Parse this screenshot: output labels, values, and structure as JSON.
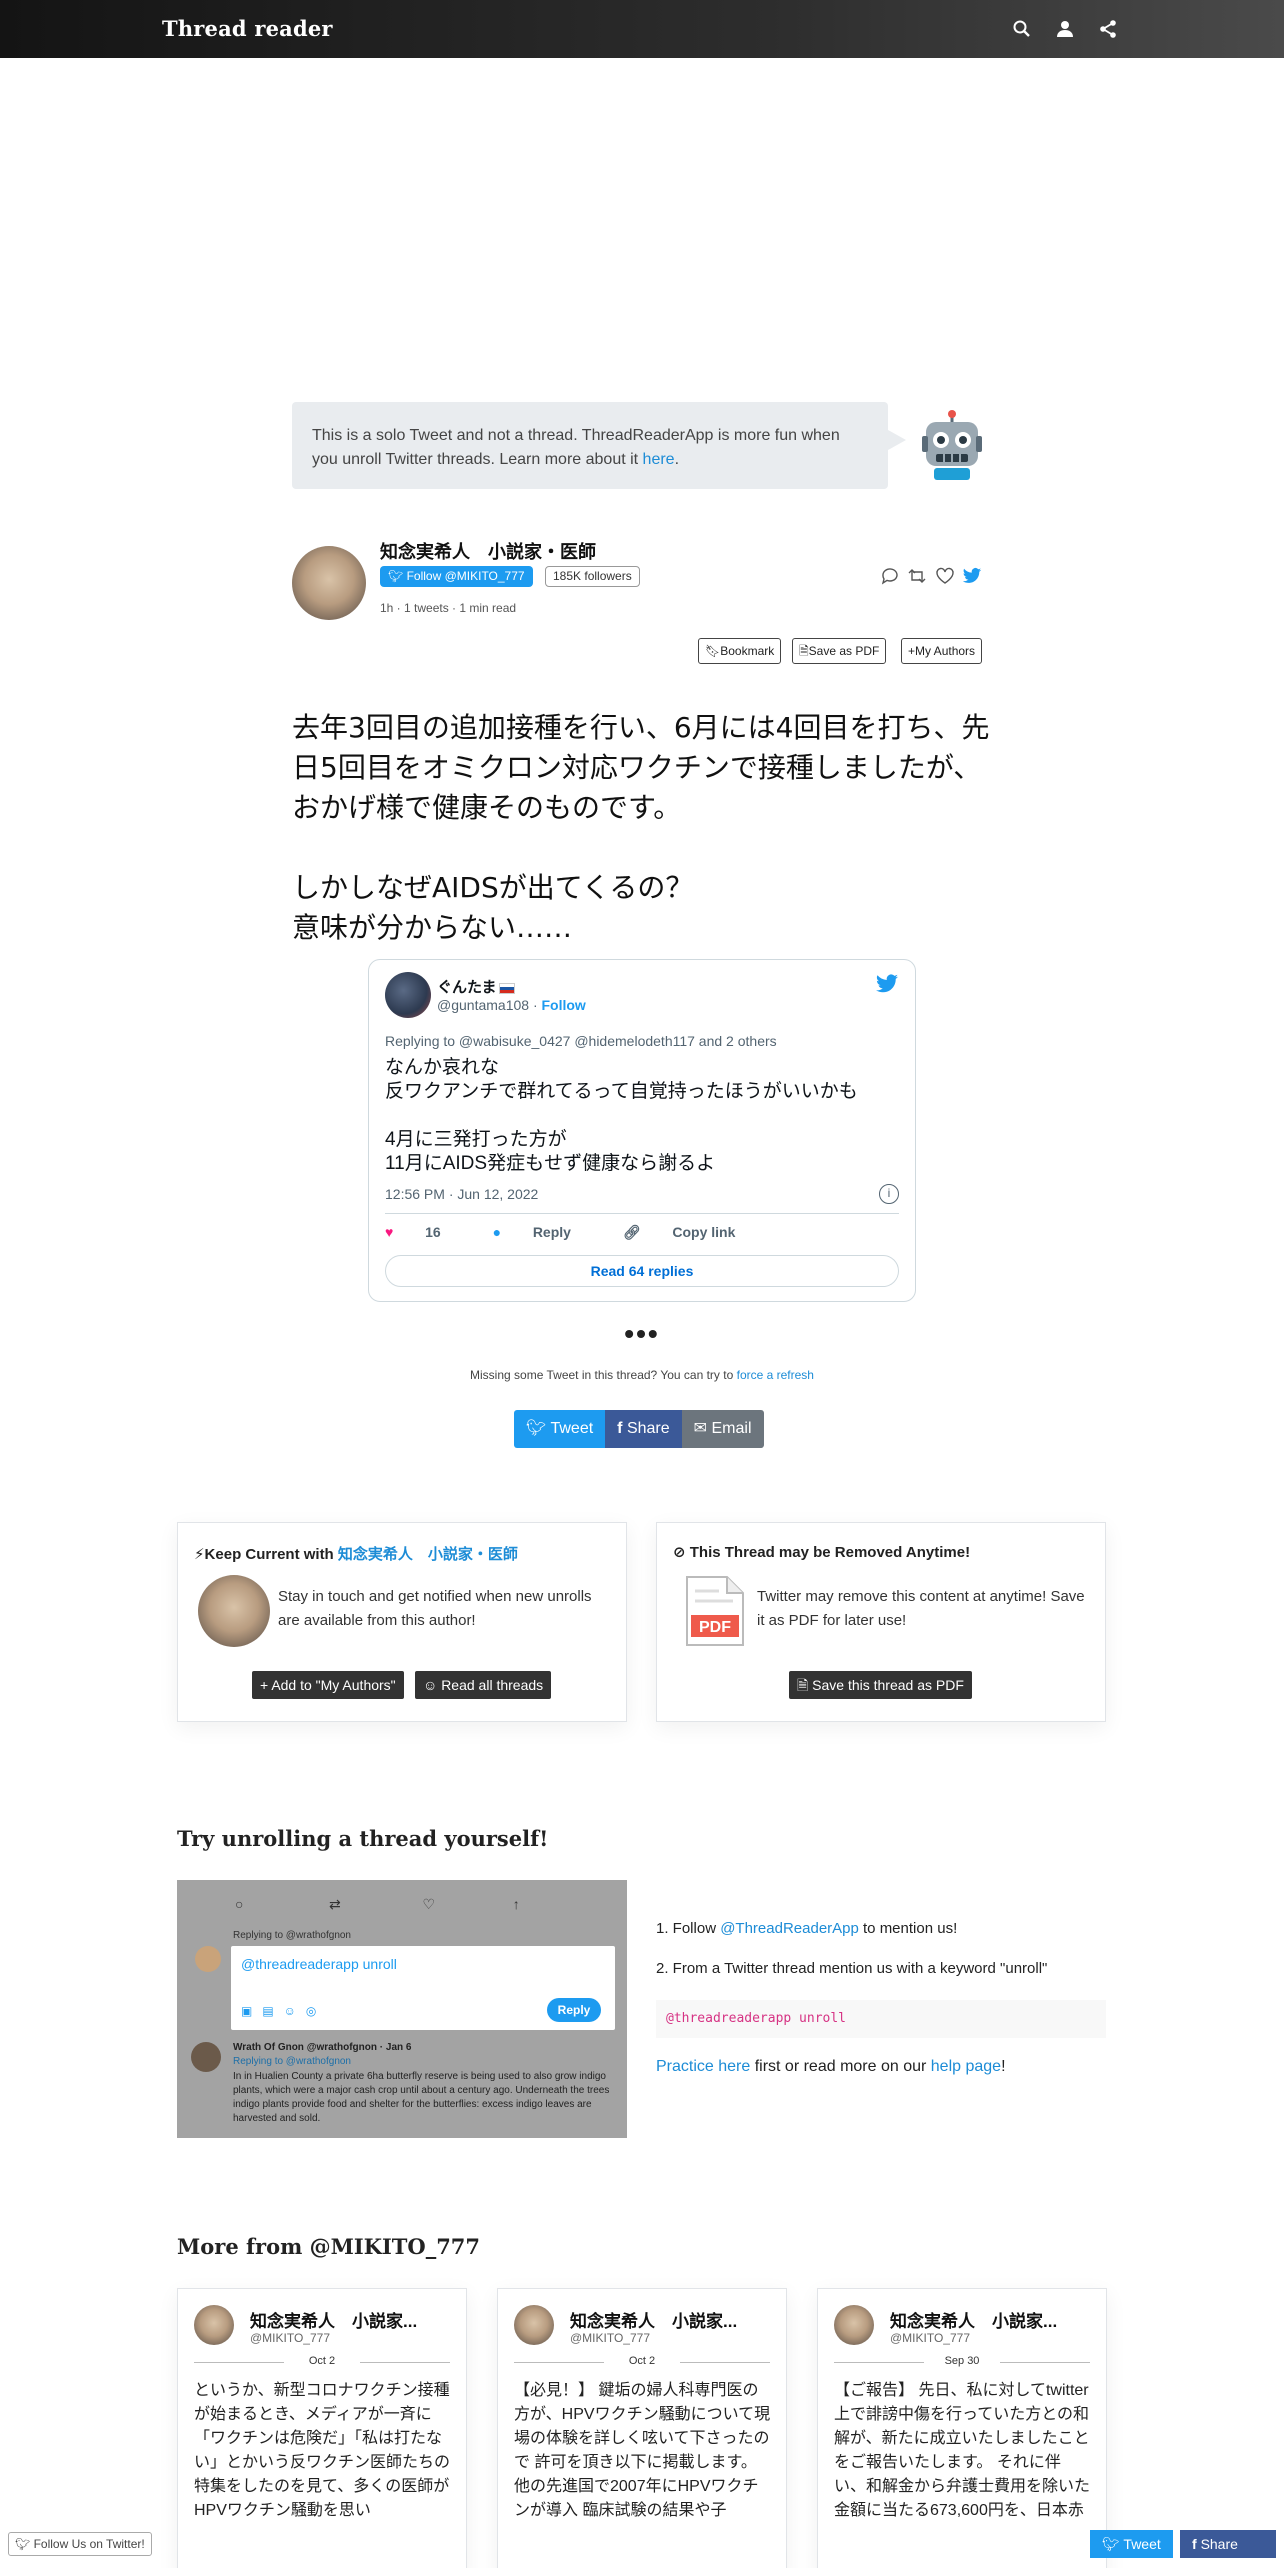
{
  "nav": {
    "brand": "Thread reader",
    "icons": [
      "search-icon",
      "user-icon",
      "share-icon"
    ]
  },
  "notice": {
    "text": "This is a solo Tweet and not a thread. ThreadReaderApp is more fun when you unroll Twitter threads. Learn more about it ",
    "link": "here",
    "end": "."
  },
  "author": {
    "name": "知念実希人　小説家・医師",
    "follow": "Follow @MIKITO_777",
    "followers": "185K followers",
    "meta": "1h · 1 tweets · 1 min read"
  },
  "tools": {
    "bookmark": "Bookmark",
    "pdf": "Save as PDF",
    "authors": "My Authors"
  },
  "tweet": {
    "text": "去年3回目の追加接種を行い、6月には4回目を打ち、先日5回目をオミクロン対応ワクチンで接種しましたが、おかげ様で健康そのものです。\n\nしかしなぜAIDSが出てくるの？\n意味が分からない……"
  },
  "embed": {
    "name": "ぐんたま",
    "handle": "@guntama108 · ",
    "follow": "Follow",
    "replying": "Replying to @wabisuke_0427 @hidemelodeth117 and 2 others",
    "text": "なんか哀れな\n反ワクアンチで群れてるって自覚持ったほうがいいかも\n\n4月に三発打った方が\n11月にAIDS発症もせず健康なら謝るよ",
    "time": "12:56 PM · Jun 12, 2022",
    "likes": "16",
    "reply": "Reply",
    "copy": "Copy link",
    "read": "Read 64 replies"
  },
  "missing": {
    "text": "Missing some Tweet in this thread? You can try to ",
    "link": "force a refresh"
  },
  "share": {
    "tweet": "Tweet",
    "share": "Share",
    "email": "Email"
  },
  "keep": {
    "title": "Keep Current with ",
    "name": "知念実希人　小説家・医師",
    "text": "Stay in touch and get notified when new unrolls are available from this author!",
    "add": "Add to \"My Authors\"",
    "read": "Read all threads"
  },
  "remove": {
    "title": "This Thread may be Removed Anytime!",
    "text": "Twitter may remove this content at anytime! Save it as PDF for later use!",
    "button": "Save this thread as PDF",
    "pdf_label": "PDF"
  },
  "try": {
    "heading": "Try unrolling a thread yourself!",
    "step1_pre": "1. Follow ",
    "step1_link": "@ThreadReaderApp",
    "step1_post": " to mention us!",
    "step2": "2. From a Twitter thread mention us with a keyword \"unroll\"",
    "code": "@threadreaderapp unroll",
    "practice_link": "Practice here",
    "practice_mid": " first or read more on our ",
    "help_link": "help page",
    "practice_end": "!",
    "img_replying": "Replying to @wrathofgnon",
    "img_input": "@threadreaderapp unroll",
    "img_reply_btn": "Reply",
    "img_author": "Wrath Of Gnon @wrathofgnon · Jan 6",
    "img_replying2": "Replying to @wrathofgnon",
    "img_text": "In in Hualien County a private 6ha butterfly reserve is being used to also grow indigo plants, which were a major cash crop until about a century ago. Underneath the trees indigo plants provide food and shelter for the butterflies: excess indigo leaves are harvested and sold."
  },
  "more": {
    "heading": "More from @MIKITO_777",
    "cards": [
      {
        "name": "知念実希人　小説家...",
        "handle": "@MIKITO_777",
        "date": "Oct 2",
        "text": "というか、新型コロナワクチン接種が始まるとき、メディアが一斉に「ワクチンは危険だ」「私は打たない」とかいう反ワクチン医師たちの特集をしたのを見て、多くの医師がHPVワクチン騒動を思い"
      },
      {
        "name": "知念実希人　小説家...",
        "handle": "@MIKITO_777",
        "date": "Oct 2",
        "text": "【必見！】 鍵垢の婦人科専門医の方が、HPVワクチン騒動について現場の体験を詳しく呟いて下さったので 許可を頂き以下に掲載します。 他の先進国で2007年にHPVワクチンが導入 臨床試験の結果や子"
      },
      {
        "name": "知念実希人　小説家...",
        "handle": "@MIKITO_777",
        "date": "Sep 30",
        "text": "【ご報告】 先日、私に対してtwitter上で誹謗中傷を行っていた方との和解が、新たに成立いたしましたことをご報告いたします。 それに伴い、和解金から弁護士費用を除いた金額に当たる673,600円を、日本赤"
      }
    ]
  },
  "footer": {
    "follow": "Follow Us on Twitter!",
    "tweet": "Tweet",
    "share": "Share"
  },
  "colors": {
    "accent": "#1d8cd6",
    "twitter": "#1d9bf0",
    "facebook": "#3b5998",
    "email": "#6c757d"
  }
}
